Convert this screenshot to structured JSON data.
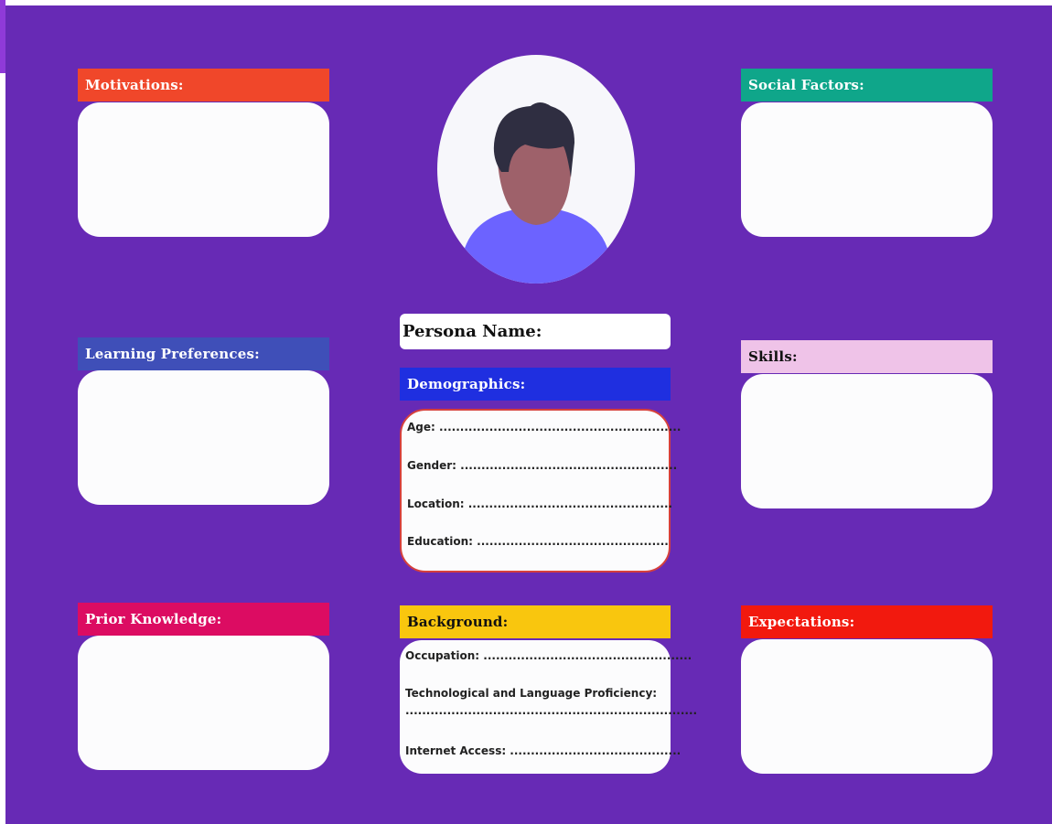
{
  "sections": {
    "motivations": "Motivations:",
    "social_factors": "Social Factors:",
    "learning_preferences": "Learning Preferences:",
    "skills": "Skills:",
    "prior_knowledge": "Prior Knowledge:",
    "expectations": "Expectations:",
    "demographics": "Demographics:",
    "background": "Background:"
  },
  "persona_name_label": "Persona Name:",
  "demographics_fields": {
    "age": "Age: ..........................................................",
    "gender": "Gender: ....................................................",
    "location": "Location: .................................................",
    "education": "Education: .............................................."
  },
  "background_fields": {
    "occupation": "Occupation: ..................................................",
    "tech_language": "Technological and Language Proficiency:",
    "tech_language_dots": "......................................................................",
    "internet_access": "Internet Access: ........................................."
  },
  "colors": {
    "background": "#672ab5",
    "motivations": "#f0472a",
    "social_factors": "#0fa68a",
    "learning_preferences": "#3f4fb8",
    "skills": "#efc3e8",
    "prior_knowledge": "#dc0c62",
    "expectations": "#f2190e",
    "demographics": "#1f2fe0",
    "background_header": "#f9c60e",
    "demographics_border": "#d6403c"
  },
  "icons": {
    "avatar": "person-avatar-icon"
  }
}
